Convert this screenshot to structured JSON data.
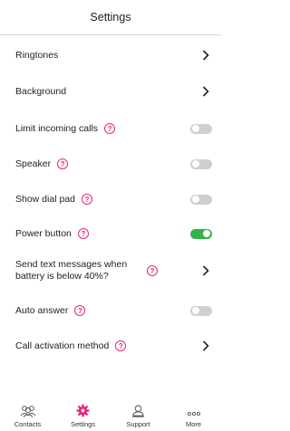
{
  "header": {
    "title": "Settings"
  },
  "settings": [
    {
      "label": "Ringtones",
      "control": "chevron",
      "help": false
    },
    {
      "label": "Background",
      "control": "chevron",
      "help": false
    },
    {
      "label": "Limit incoming calls",
      "control": "toggle",
      "on": false,
      "help": true
    },
    {
      "label": "Speaker",
      "control": "toggle",
      "on": false,
      "help": true
    },
    {
      "label": "Show dial pad",
      "control": "toggle",
      "on": false,
      "help": true
    },
    {
      "label": "Power button",
      "control": "toggle",
      "on": true,
      "help": true
    },
    {
      "label": "Send text messages when battery is below 40%?",
      "control": "chevron",
      "help": true
    },
    {
      "label": "Auto answer",
      "control": "toggle",
      "on": false,
      "help": true
    },
    {
      "label": "Call activation method",
      "control": "chevron",
      "help": true
    }
  ],
  "help_glyph": "?",
  "tabs": [
    {
      "label": "Contacts",
      "icon": "contacts-icon",
      "active": false
    },
    {
      "label": "Settings",
      "icon": "gear-icon",
      "active": true
    },
    {
      "label": "Support",
      "icon": "support-icon",
      "active": false
    },
    {
      "label": "More",
      "icon": "more-icon",
      "active": false
    }
  ],
  "colors": {
    "accent": "#e0287a",
    "toggle_on": "#35b14a",
    "toggle_off": "#cfcfcf"
  }
}
